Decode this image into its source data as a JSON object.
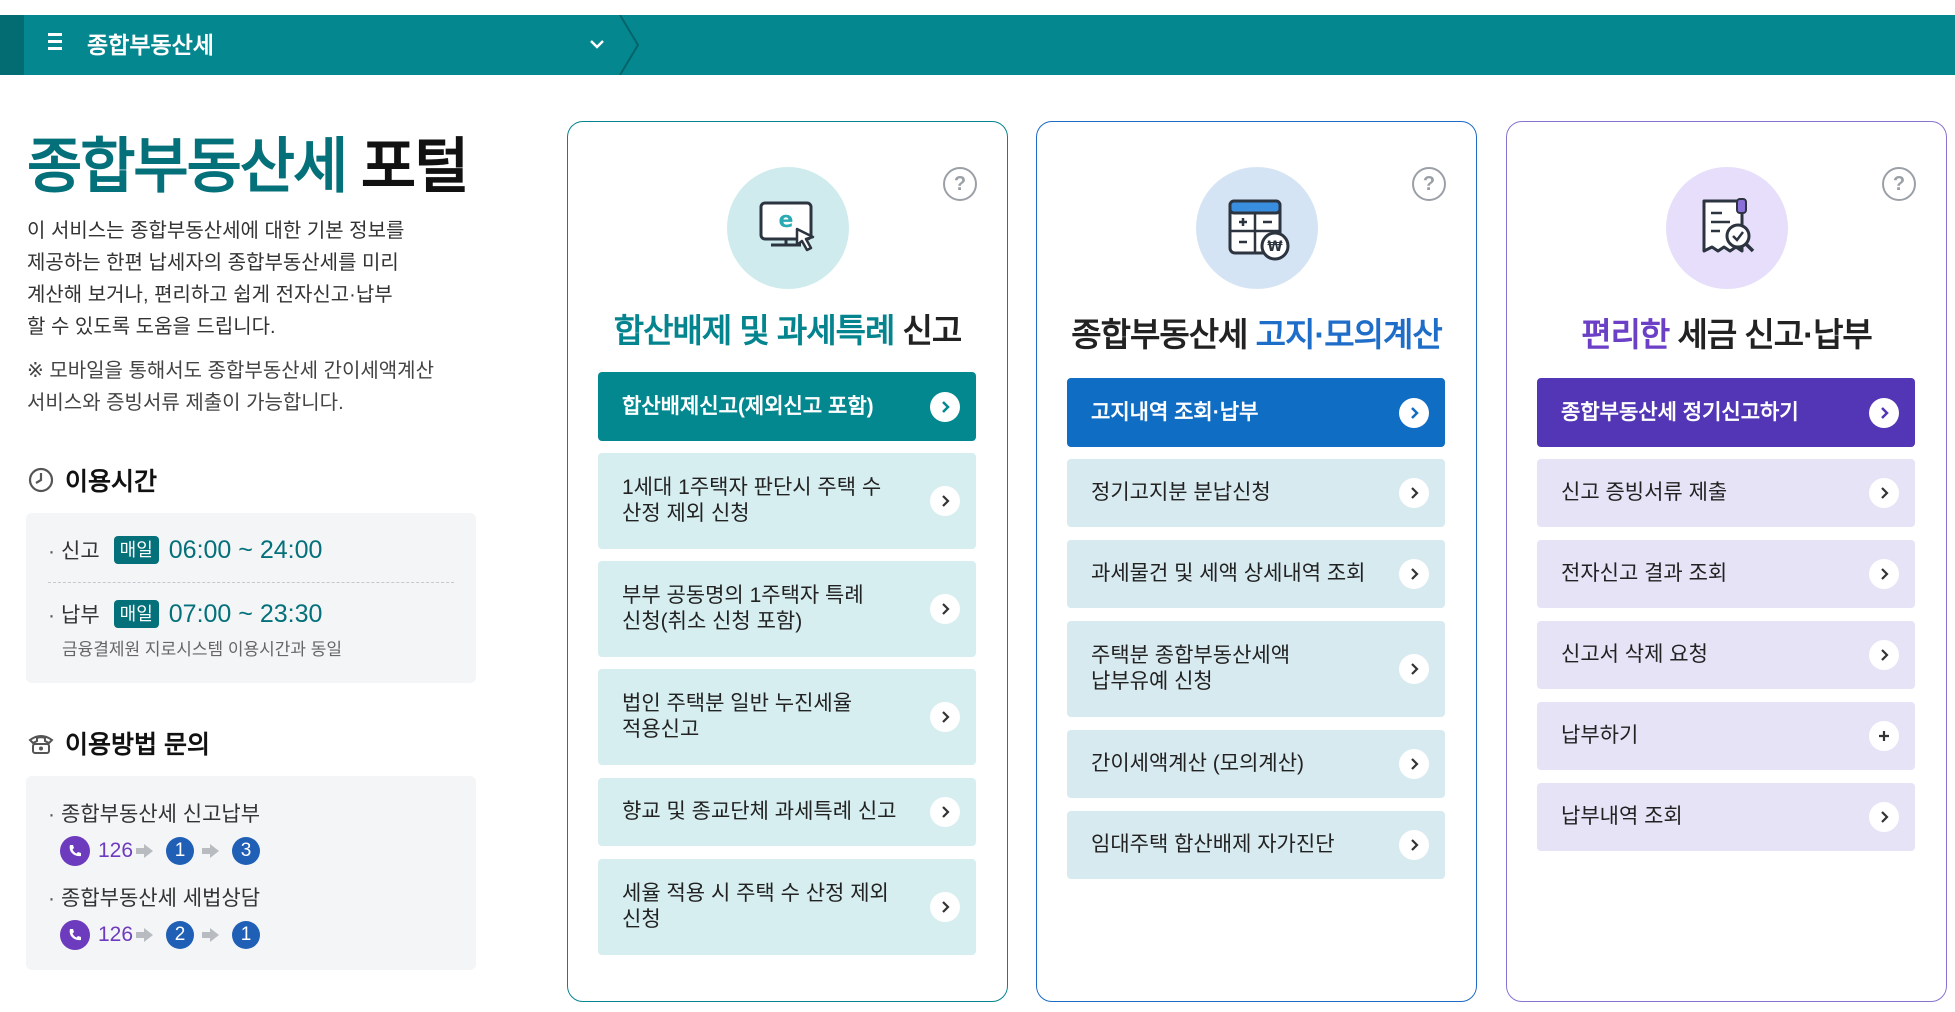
{
  "topbar": {
    "title": "종합부동산세"
  },
  "portal": {
    "title_accent": "종합부동산세",
    "title_rest": " 포털",
    "intro_lines": [
      "이 서비스는 종합부동산세에 대한 기본 정보를",
      "제공하는 한편 납세자의 종합부동산세를 미리",
      "계산해 보거나, 편리하고 쉽게 전자신고·납부",
      "할 수 있도록 도움을 드립니다."
    ],
    "note_lines": [
      "※ 모바일을 통해서도 종합부동산세 간이세액계산",
      "서비스와 증빙서류 제출이 가능합니다."
    ]
  },
  "hours": {
    "heading": "이용시간",
    "rows": [
      {
        "label": "신고",
        "badge": "매일",
        "time": "06:00 ~ 24:00"
      },
      {
        "label": "납부",
        "badge": "매일",
        "time": "07:00 ~ 23:30"
      }
    ],
    "sub": "금융결제원 지로시스템 이용시간과 동일"
  },
  "contact": {
    "heading": "이용방법 문의",
    "items": [
      {
        "label": "종합부동산세 신고납부",
        "number": "126",
        "step1": "1",
        "step2": "3"
      },
      {
        "label": "종합부동산세 세법상담",
        "number": "126",
        "step1": "2",
        "step2": "1"
      }
    ]
  },
  "cards": [
    {
      "help": "?",
      "icon": "monitor-e-icon",
      "title_accent": "합산배제 및 과세특례",
      "title_rest": " 신고",
      "primary": "합산배제신고(제외신고 포함)",
      "items": [
        [
          "1세대 1주택자 판단시 주택 수",
          "산정 제외 신청"
        ],
        [
          "부부 공동명의 1주택자 특례",
          "신청(취소 신청 포함)"
        ],
        [
          "법인 주택분 일반 누진세율",
          "적용신고"
        ],
        [
          "향교 및 종교단체 과세특례 신고"
        ],
        [
          "세율 적용 시 주택 수 산정 제외",
          "신청"
        ]
      ]
    },
    {
      "help": "?",
      "icon": "calculator-icon",
      "title_rest": "종합부동산세 ",
      "title_accent": "고지·모의계산",
      "primary": "고지내역 조회·납부",
      "items": [
        [
          "정기고지분 분납신청"
        ],
        [
          "과세물건 및 세액 상세내역 조회"
        ],
        [
          "주택분 종합부동산세액",
          "납부유예 신청"
        ],
        [
          "간이세액계산 (모의계산)"
        ],
        [
          "임대주택 합산배제 자가진단"
        ]
      ]
    },
    {
      "help": "?",
      "icon": "receipt-check-icon",
      "title_accent": "편리한",
      "title_rest": " 세금 신고·납부",
      "primary": "종합부동산세 정기신고하기",
      "items": [
        [
          "신고 증빙서류 제출"
        ],
        [
          "전자신고 결과 조회"
        ],
        [
          "신고서 삭제 요청"
        ],
        [
          "납부하기"
        ],
        [
          "납부내역 조회"
        ]
      ]
    }
  ],
  "colors": {
    "teal": "#04878f",
    "blue": "#106dc4",
    "purple": "#5336b5"
  }
}
